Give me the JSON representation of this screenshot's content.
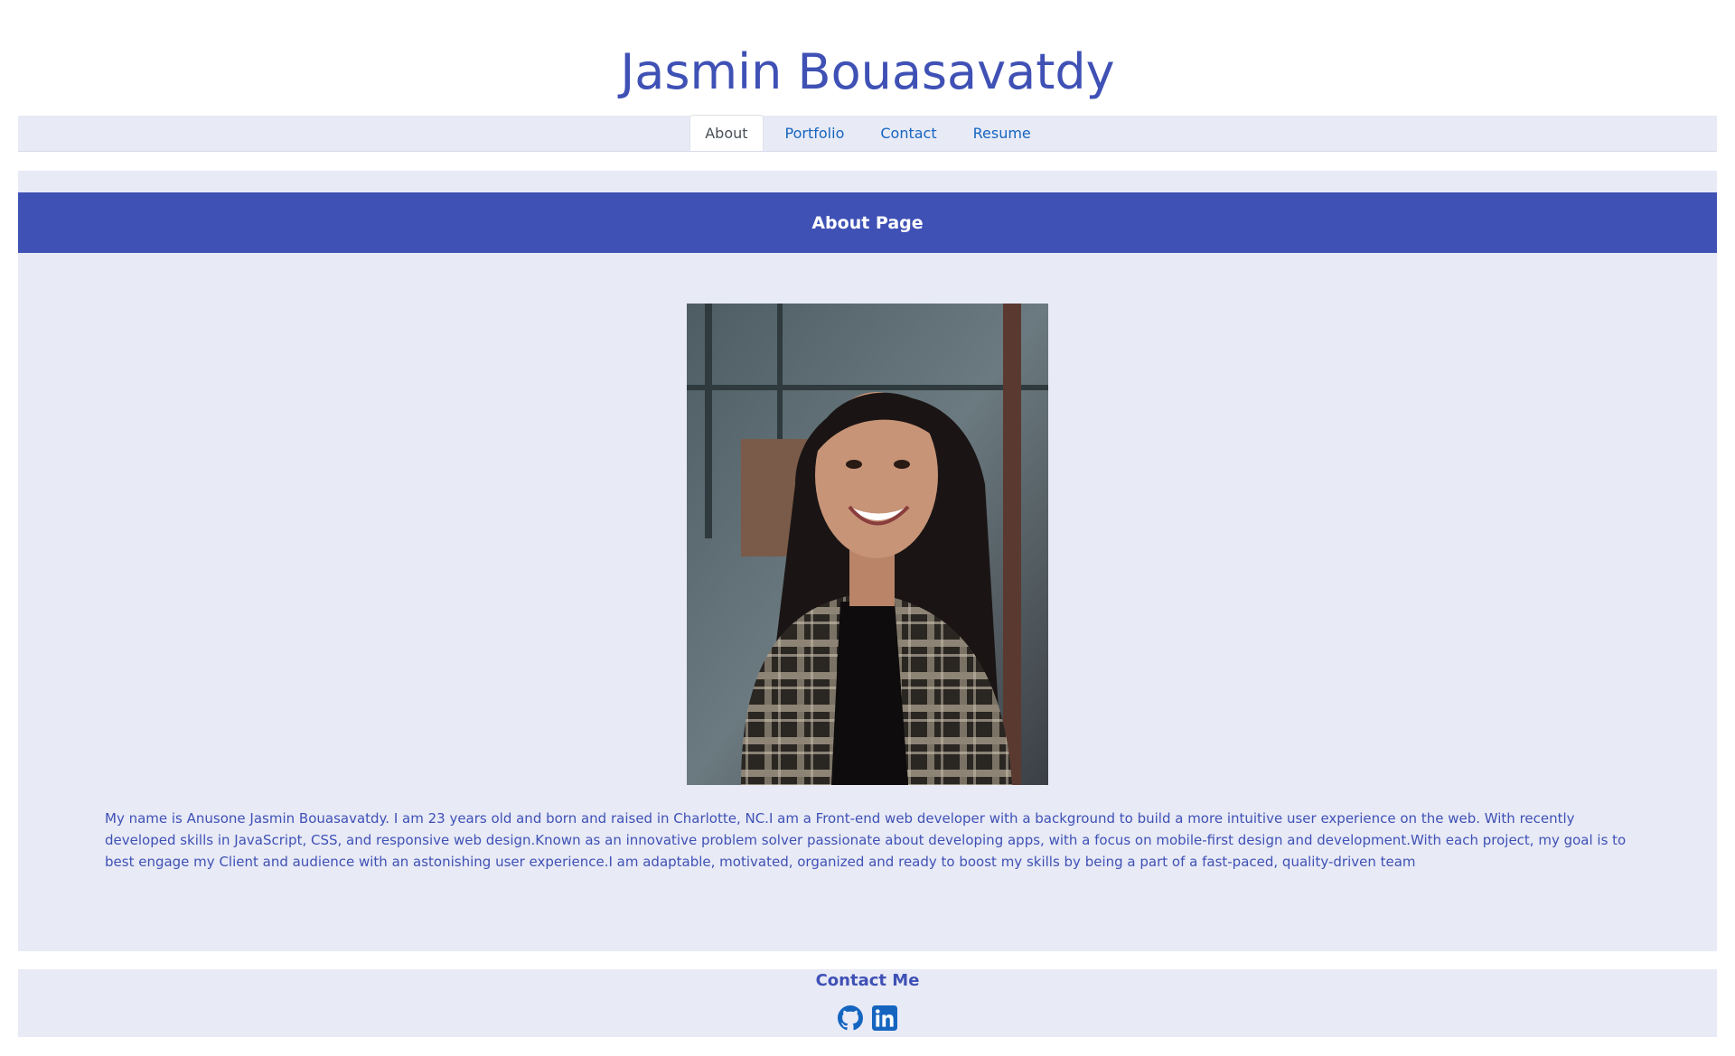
{
  "header": {
    "title": "Jasmin Bouasavatdy"
  },
  "nav": {
    "tabs": [
      {
        "label": "About",
        "active": true
      },
      {
        "label": "Portfolio",
        "active": false
      },
      {
        "label": "Contact",
        "active": false
      },
      {
        "label": "Resume",
        "active": false
      }
    ]
  },
  "main": {
    "heading": "About Page",
    "bio": "My name is Anusone Jasmin Bouasavatdy. I am 23 years old and born and raised in Charlotte, NC.I am a Front-end web developer with a background to build a more intuitive user experience on the web. With recently developed skills in JavaScript, CSS, and responsive web design.Known as an innovative problem solver passionate about developing apps, with a focus on mobile-first design and development.With each project, my goal is to best engage my Client and audience with an astonishing user experience.I am adaptable, motivated, organized and ready to boost my skills by being a part of a fast-paced, quality-driven team"
  },
  "footer": {
    "contact_title": "Contact Me",
    "icons": [
      "github-icon",
      "linkedin-icon"
    ]
  },
  "colors": {
    "accent": "#3f51b5",
    "panel": "#e8eaf6",
    "link": "#1565c0"
  }
}
